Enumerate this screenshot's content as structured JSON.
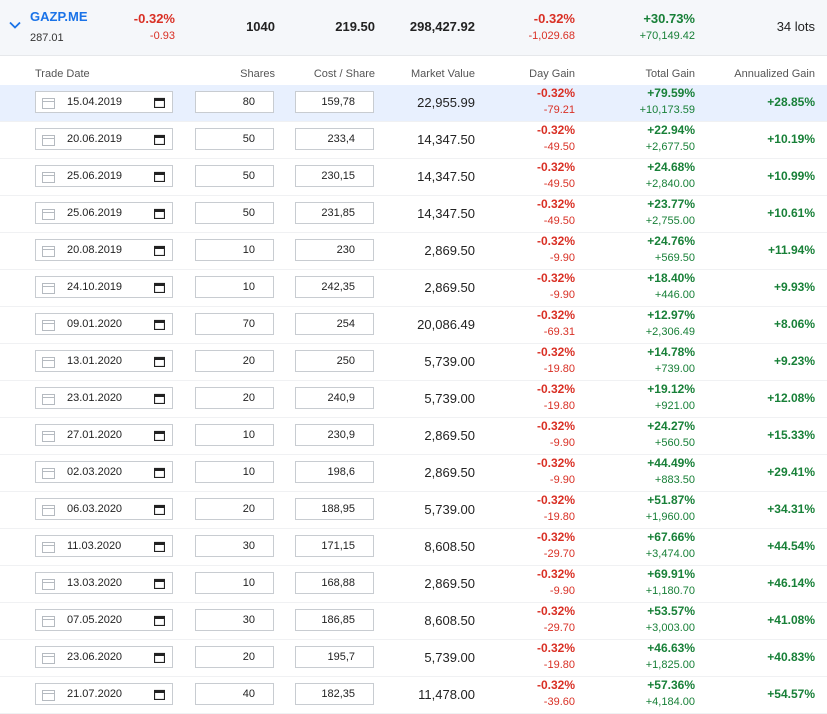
{
  "summary": {
    "ticker": "GAZP.ME",
    "price": "287.01",
    "day_change_pct": "-0.32%",
    "day_change_abs": "-0.93",
    "shares": "1040",
    "cost_per_share": "219.50",
    "market_value": "298,427.92",
    "day_gain_pct": "-0.32%",
    "day_gain_abs": "-1,029.68",
    "total_gain_pct": "+30.73%",
    "total_gain_abs": "+70,149.42",
    "lots": "34 lots"
  },
  "headers": {
    "trade_date": "Trade Date",
    "shares": "Shares",
    "cost_share": "Cost / Share",
    "market_value": "Market Value",
    "day_gain": "Day Gain",
    "total_gain": "Total Gain",
    "annualized_gain": "Annualized Gain"
  },
  "colors": {
    "accent": "#1a73e8",
    "negative": "#d93025",
    "positive": "#188038",
    "selected_row": "#e8f0fe"
  },
  "icons": {
    "expand": "chevron-down-icon",
    "date_left": "calendar-icon",
    "date_picker": "calendar-picker-icon"
  },
  "lots": [
    {
      "date": "15.04.2019",
      "shares": "80",
      "cost": "159,78",
      "mv": "22,955.99",
      "dg_pct": "-0.32%",
      "dg_abs": "-79.21",
      "tg_pct": "+79.59%",
      "tg_abs": "+10,173.59",
      "ag": "+28.85%"
    },
    {
      "date": "20.06.2019",
      "shares": "50",
      "cost": "233,4",
      "mv": "14,347.50",
      "dg_pct": "-0.32%",
      "dg_abs": "-49.50",
      "tg_pct": "+22.94%",
      "tg_abs": "+2,677.50",
      "ag": "+10.19%"
    },
    {
      "date": "25.06.2019",
      "shares": "50",
      "cost": "230,15",
      "mv": "14,347.50",
      "dg_pct": "-0.32%",
      "dg_abs": "-49.50",
      "tg_pct": "+24.68%",
      "tg_abs": "+2,840.00",
      "ag": "+10.99%"
    },
    {
      "date": "25.06.2019",
      "shares": "50",
      "cost": "231,85",
      "mv": "14,347.50",
      "dg_pct": "-0.32%",
      "dg_abs": "-49.50",
      "tg_pct": "+23.77%",
      "tg_abs": "+2,755.00",
      "ag": "+10.61%"
    },
    {
      "date": "20.08.2019",
      "shares": "10",
      "cost": "230",
      "mv": "2,869.50",
      "dg_pct": "-0.32%",
      "dg_abs": "-9.90",
      "tg_pct": "+24.76%",
      "tg_abs": "+569.50",
      "ag": "+11.94%"
    },
    {
      "date": "24.10.2019",
      "shares": "10",
      "cost": "242,35",
      "mv": "2,869.50",
      "dg_pct": "-0.32%",
      "dg_abs": "-9.90",
      "tg_pct": "+18.40%",
      "tg_abs": "+446.00",
      "ag": "+9.93%"
    },
    {
      "date": "09.01.2020",
      "shares": "70",
      "cost": "254",
      "mv": "20,086.49",
      "dg_pct": "-0.32%",
      "dg_abs": "-69.31",
      "tg_pct": "+12.97%",
      "tg_abs": "+2,306.49",
      "ag": "+8.06%"
    },
    {
      "date": "13.01.2020",
      "shares": "20",
      "cost": "250",
      "mv": "5,739.00",
      "dg_pct": "-0.32%",
      "dg_abs": "-19.80",
      "tg_pct": "+14.78%",
      "tg_abs": "+739.00",
      "ag": "+9.23%"
    },
    {
      "date": "23.01.2020",
      "shares": "20",
      "cost": "240,9",
      "mv": "5,739.00",
      "dg_pct": "-0.32%",
      "dg_abs": "-19.80",
      "tg_pct": "+19.12%",
      "tg_abs": "+921.00",
      "ag": "+12.08%"
    },
    {
      "date": "27.01.2020",
      "shares": "10",
      "cost": "230,9",
      "mv": "2,869.50",
      "dg_pct": "-0.32%",
      "dg_abs": "-9.90",
      "tg_pct": "+24.27%",
      "tg_abs": "+560.50",
      "ag": "+15.33%"
    },
    {
      "date": "02.03.2020",
      "shares": "10",
      "cost": "198,6",
      "mv": "2,869.50",
      "dg_pct": "-0.32%",
      "dg_abs": "-9.90",
      "tg_pct": "+44.49%",
      "tg_abs": "+883.50",
      "ag": "+29.41%"
    },
    {
      "date": "06.03.2020",
      "shares": "20",
      "cost": "188,95",
      "mv": "5,739.00",
      "dg_pct": "-0.32%",
      "dg_abs": "-19.80",
      "tg_pct": "+51.87%",
      "tg_abs": "+1,960.00",
      "ag": "+34.31%"
    },
    {
      "date": "11.03.2020",
      "shares": "30",
      "cost": "171,15",
      "mv": "8,608.50",
      "dg_pct": "-0.32%",
      "dg_abs": "-29.70",
      "tg_pct": "+67.66%",
      "tg_abs": "+3,474.00",
      "ag": "+44.54%"
    },
    {
      "date": "13.03.2020",
      "shares": "10",
      "cost": "168,88",
      "mv": "2,869.50",
      "dg_pct": "-0.32%",
      "dg_abs": "-9.90",
      "tg_pct": "+69.91%",
      "tg_abs": "+1,180.70",
      "ag": "+46.14%"
    },
    {
      "date": "07.05.2020",
      "shares": "30",
      "cost": "186,85",
      "mv": "8,608.50",
      "dg_pct": "-0.32%",
      "dg_abs": "-29.70",
      "tg_pct": "+53.57%",
      "tg_abs": "+3,003.00",
      "ag": "+41.08%"
    },
    {
      "date": "23.06.2020",
      "shares": "20",
      "cost": "195,7",
      "mv": "5,739.00",
      "dg_pct": "-0.32%",
      "dg_abs": "-19.80",
      "tg_pct": "+46.63%",
      "tg_abs": "+1,825.00",
      "ag": "+40.83%"
    },
    {
      "date": "21.07.2020",
      "shares": "40",
      "cost": "182,35",
      "mv": "11,478.00",
      "dg_pct": "-0.32%",
      "dg_abs": "-39.60",
      "tg_pct": "+57.36%",
      "tg_abs": "+4,184.00",
      "ag": "+54.57%"
    }
  ]
}
